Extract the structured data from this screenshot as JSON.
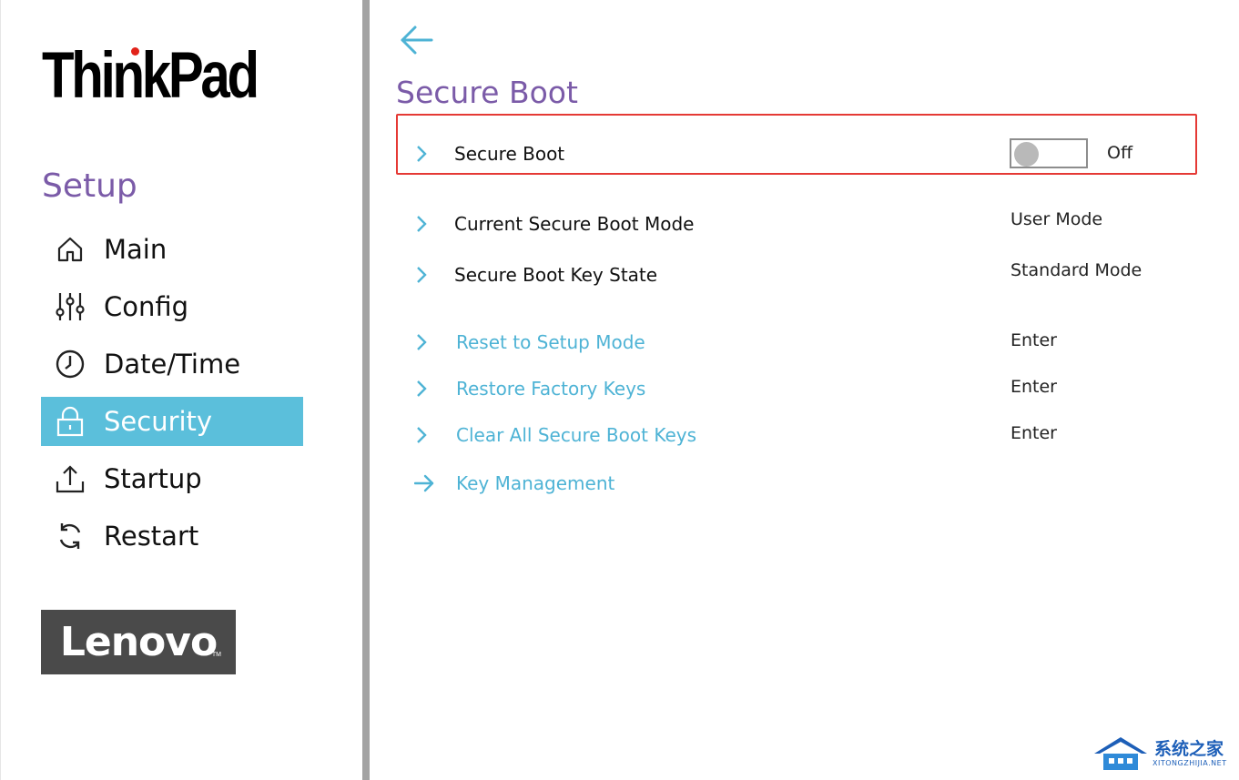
{
  "brand": {
    "name": "ThinkPad"
  },
  "sidebar": {
    "title": "Setup",
    "items": [
      {
        "label": "Main",
        "icon": "home-icon",
        "active": false
      },
      {
        "label": "Config",
        "icon": "sliders-icon",
        "active": false
      },
      {
        "label": "Date/Time",
        "icon": "clock-icon",
        "active": false
      },
      {
        "label": "Security",
        "icon": "lock-icon",
        "active": true
      },
      {
        "label": "Startup",
        "icon": "upload-icon",
        "active": false
      },
      {
        "label": "Restart",
        "icon": "refresh-icon",
        "active": false
      }
    ],
    "footer_logo": "Lenovo",
    "footer_logo_tm": "TM"
  },
  "page": {
    "title": "Secure Boot",
    "back_icon": "arrow-left-icon"
  },
  "settings": {
    "secure_boot": {
      "label": "Secure Boot",
      "state": "Off",
      "enabled": false
    },
    "current_mode": {
      "label": "Current Secure Boot Mode",
      "value": "User Mode"
    },
    "key_state": {
      "label": "Secure Boot Key State",
      "value": "Standard Mode"
    },
    "reset_setup": {
      "label": "Reset to Setup Mode",
      "value": "Enter"
    },
    "restore_keys": {
      "label": "Restore Factory Keys",
      "value": "Enter"
    },
    "clear_keys": {
      "label": "Clear All Secure Boot Keys",
      "value": "Enter"
    },
    "key_management": {
      "label": "Key Management"
    }
  },
  "watermark": {
    "text": "系统之家",
    "url": "XITONGZHIJIA.NET"
  },
  "colors": {
    "accent": "#5bbfdb",
    "link": "#4eb3d5",
    "title_purple": "#7b5ba8",
    "highlight_red": "#e53935",
    "divider": "#a3a3a3",
    "logo_bg": "#4a4a4a"
  }
}
